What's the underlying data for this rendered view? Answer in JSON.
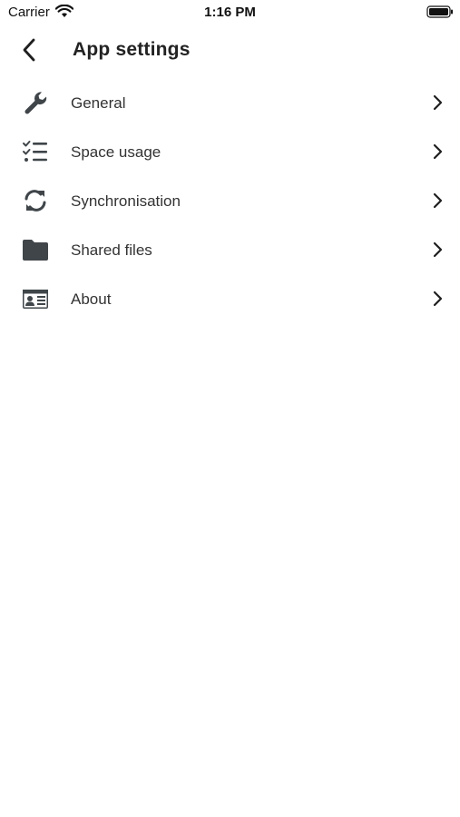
{
  "status_bar": {
    "carrier": "Carrier",
    "time": "1:16 PM",
    "wifi_icon": "wifi-icon",
    "battery_icon": "battery-icon"
  },
  "nav": {
    "back_icon": "chevron-left-icon",
    "title": "App settings"
  },
  "menu": {
    "items": [
      {
        "label": "General",
        "icon": "wrench-icon"
      },
      {
        "label": "Space usage",
        "icon": "checklist-icon"
      },
      {
        "label": "Synchronisation",
        "icon": "sync-icon"
      },
      {
        "label": "Shared files",
        "icon": "folder-icon"
      },
      {
        "label": "About",
        "icon": "id-card-icon"
      }
    ],
    "chevron_icon": "chevron-right-icon"
  },
  "colors": {
    "icon": "#3f4549",
    "text": "#333333",
    "background": "#ffffff"
  }
}
